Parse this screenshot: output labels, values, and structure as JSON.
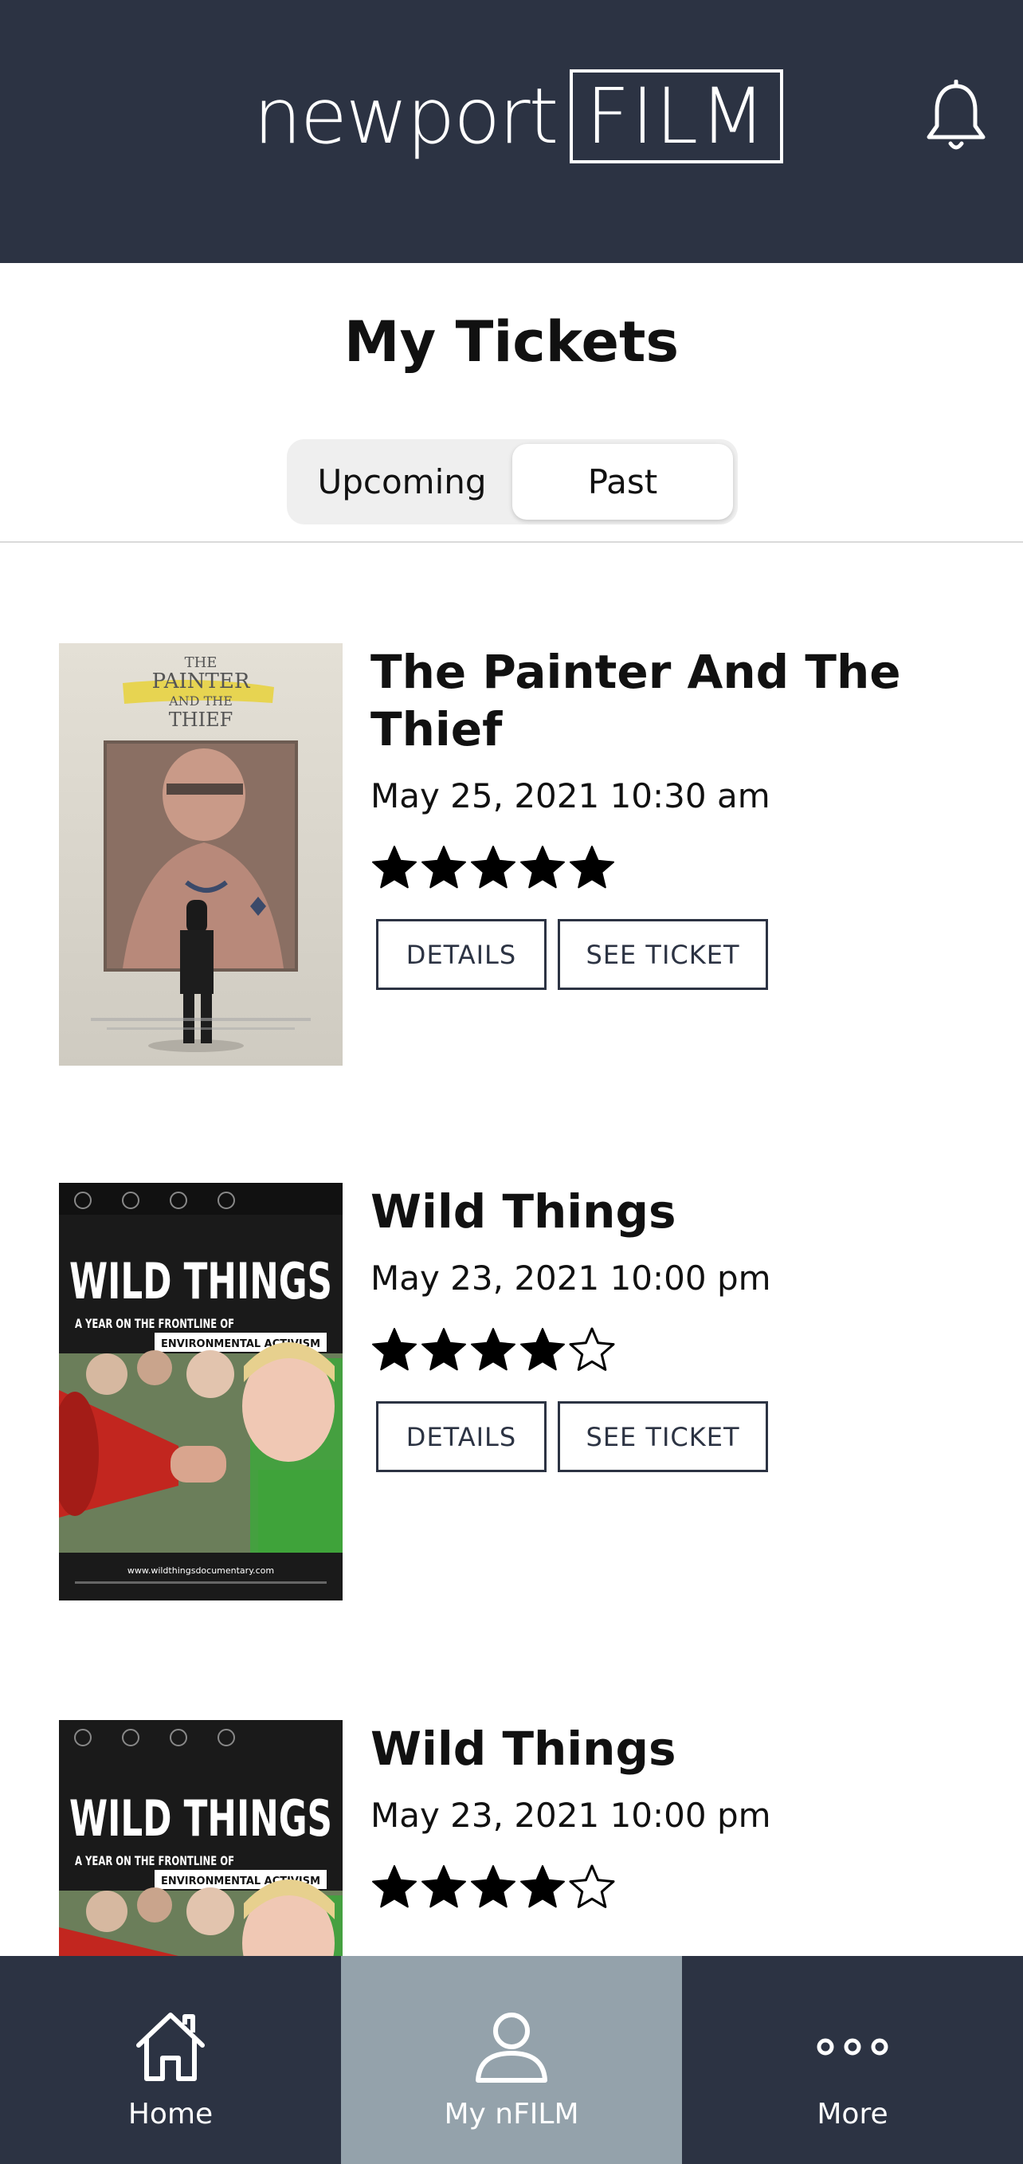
{
  "header": {
    "logo_word": "newport",
    "logo_box": "FILM",
    "icons": {
      "bell": "bell-icon"
    }
  },
  "page": {
    "title": "My Tickets"
  },
  "segmented": {
    "options": [
      "Upcoming",
      "Past"
    ],
    "selected": "Past"
  },
  "tickets": [
    {
      "title": "The Painter And The Thief",
      "datetime": "May 25, 2021 10:30 am",
      "rating": 5,
      "rating_max": 5,
      "details_label": "DETAILS",
      "see_ticket_label": "SEE TICKET",
      "poster_text": {
        "line1": "THE",
        "line2": "PAINTER",
        "line3": "AND THE",
        "line4": "THIEF"
      }
    },
    {
      "title": "Wild Things",
      "datetime": "May 23, 2021 10:00 pm",
      "rating": 4,
      "rating_max": 5,
      "details_label": "DETAILS",
      "see_ticket_label": "SEE TICKET",
      "poster_text": {
        "title": "WILD THINGS",
        "tagline": "A YEAR ON THE FRONTLINE OF",
        "subtitle": "ENVIRONMENTAL ACTIVISM",
        "url": "www.wildthingsdocumentary.com"
      }
    },
    {
      "title": "Wild Things",
      "datetime": "May 23, 2021 10:00 pm",
      "rating": 4,
      "rating_max": 5,
      "poster_text": {
        "title": "WILD THINGS",
        "tagline": "A YEAR ON THE FRONTLINE OF",
        "subtitle": "ENVIRONMENTAL ACTIVISM"
      }
    }
  ],
  "tabbar": {
    "items": [
      {
        "label": "Home",
        "icon": "home-icon"
      },
      {
        "label": "My nFILM",
        "icon": "user-icon"
      },
      {
        "label": "More",
        "icon": "more-icon"
      }
    ],
    "active": "My nFILM"
  },
  "colors": {
    "header_bg": "#2c3343",
    "tab_active_bg": "#94a2ab",
    "button_border": "#2c3343"
  }
}
